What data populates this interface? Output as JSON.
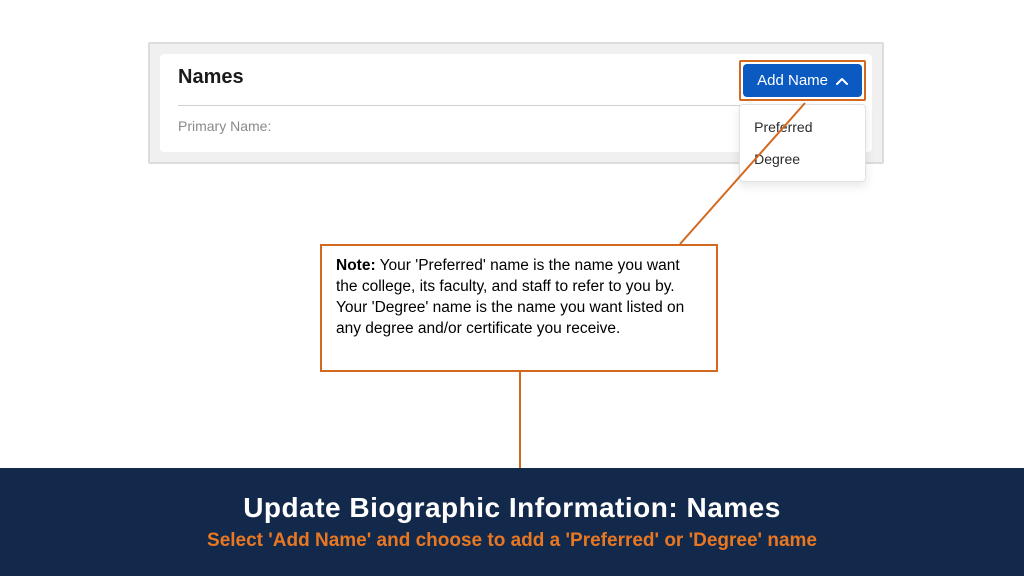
{
  "panel": {
    "title": "Names",
    "primary_name_label": "Primary Name:",
    "add_name_button": "Add Name",
    "dropdown": {
      "options": [
        "Preferred",
        "Degree"
      ]
    }
  },
  "note": {
    "label": "Note:",
    "text": " Your 'Preferred' name is the name you want the college, its faculty, and staff to refer to you by. Your 'Degree' name is the name you want listed on any degree and/or certificate you receive."
  },
  "banner": {
    "title": "Update Biographic Information: Names",
    "subtitle": "Select 'Add Name' and choose to add a 'Preferred' or 'Degree' name"
  },
  "colors": {
    "accent_orange": "#d2691e",
    "button_blue": "#0a5ac2",
    "banner_bg": "#13294b",
    "banner_accent": "#e87722"
  }
}
